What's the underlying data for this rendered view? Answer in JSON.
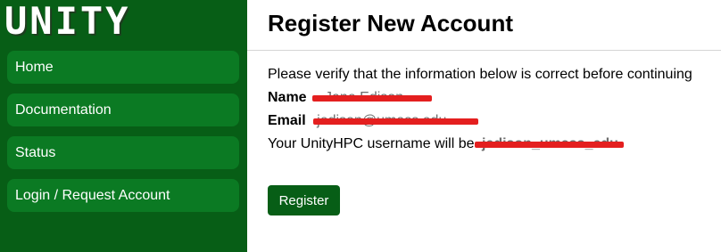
{
  "brand": {
    "logo_text": "UNITY"
  },
  "sidebar": {
    "items": [
      {
        "label": "Home"
      },
      {
        "label": "Documentation"
      },
      {
        "label": "Status"
      },
      {
        "label": "Login / Request Account"
      }
    ]
  },
  "main": {
    "title": "Register New Account",
    "intro": "Please verify that the information below is correct before continuing",
    "name_label": "Name",
    "name_value": "Jane Edison",
    "email_label": "Email",
    "email_value": "jedison@umass.edu",
    "username_prefix": "Your UnityHPC username will be",
    "username_value": "jedison_umass_edu",
    "register_label": "Register"
  },
  "colors": {
    "sidebar_bg": "#075e16",
    "nav_item_bg": "#0b7a23",
    "button_bg": "#075e16",
    "redaction": "#e41f1f"
  }
}
